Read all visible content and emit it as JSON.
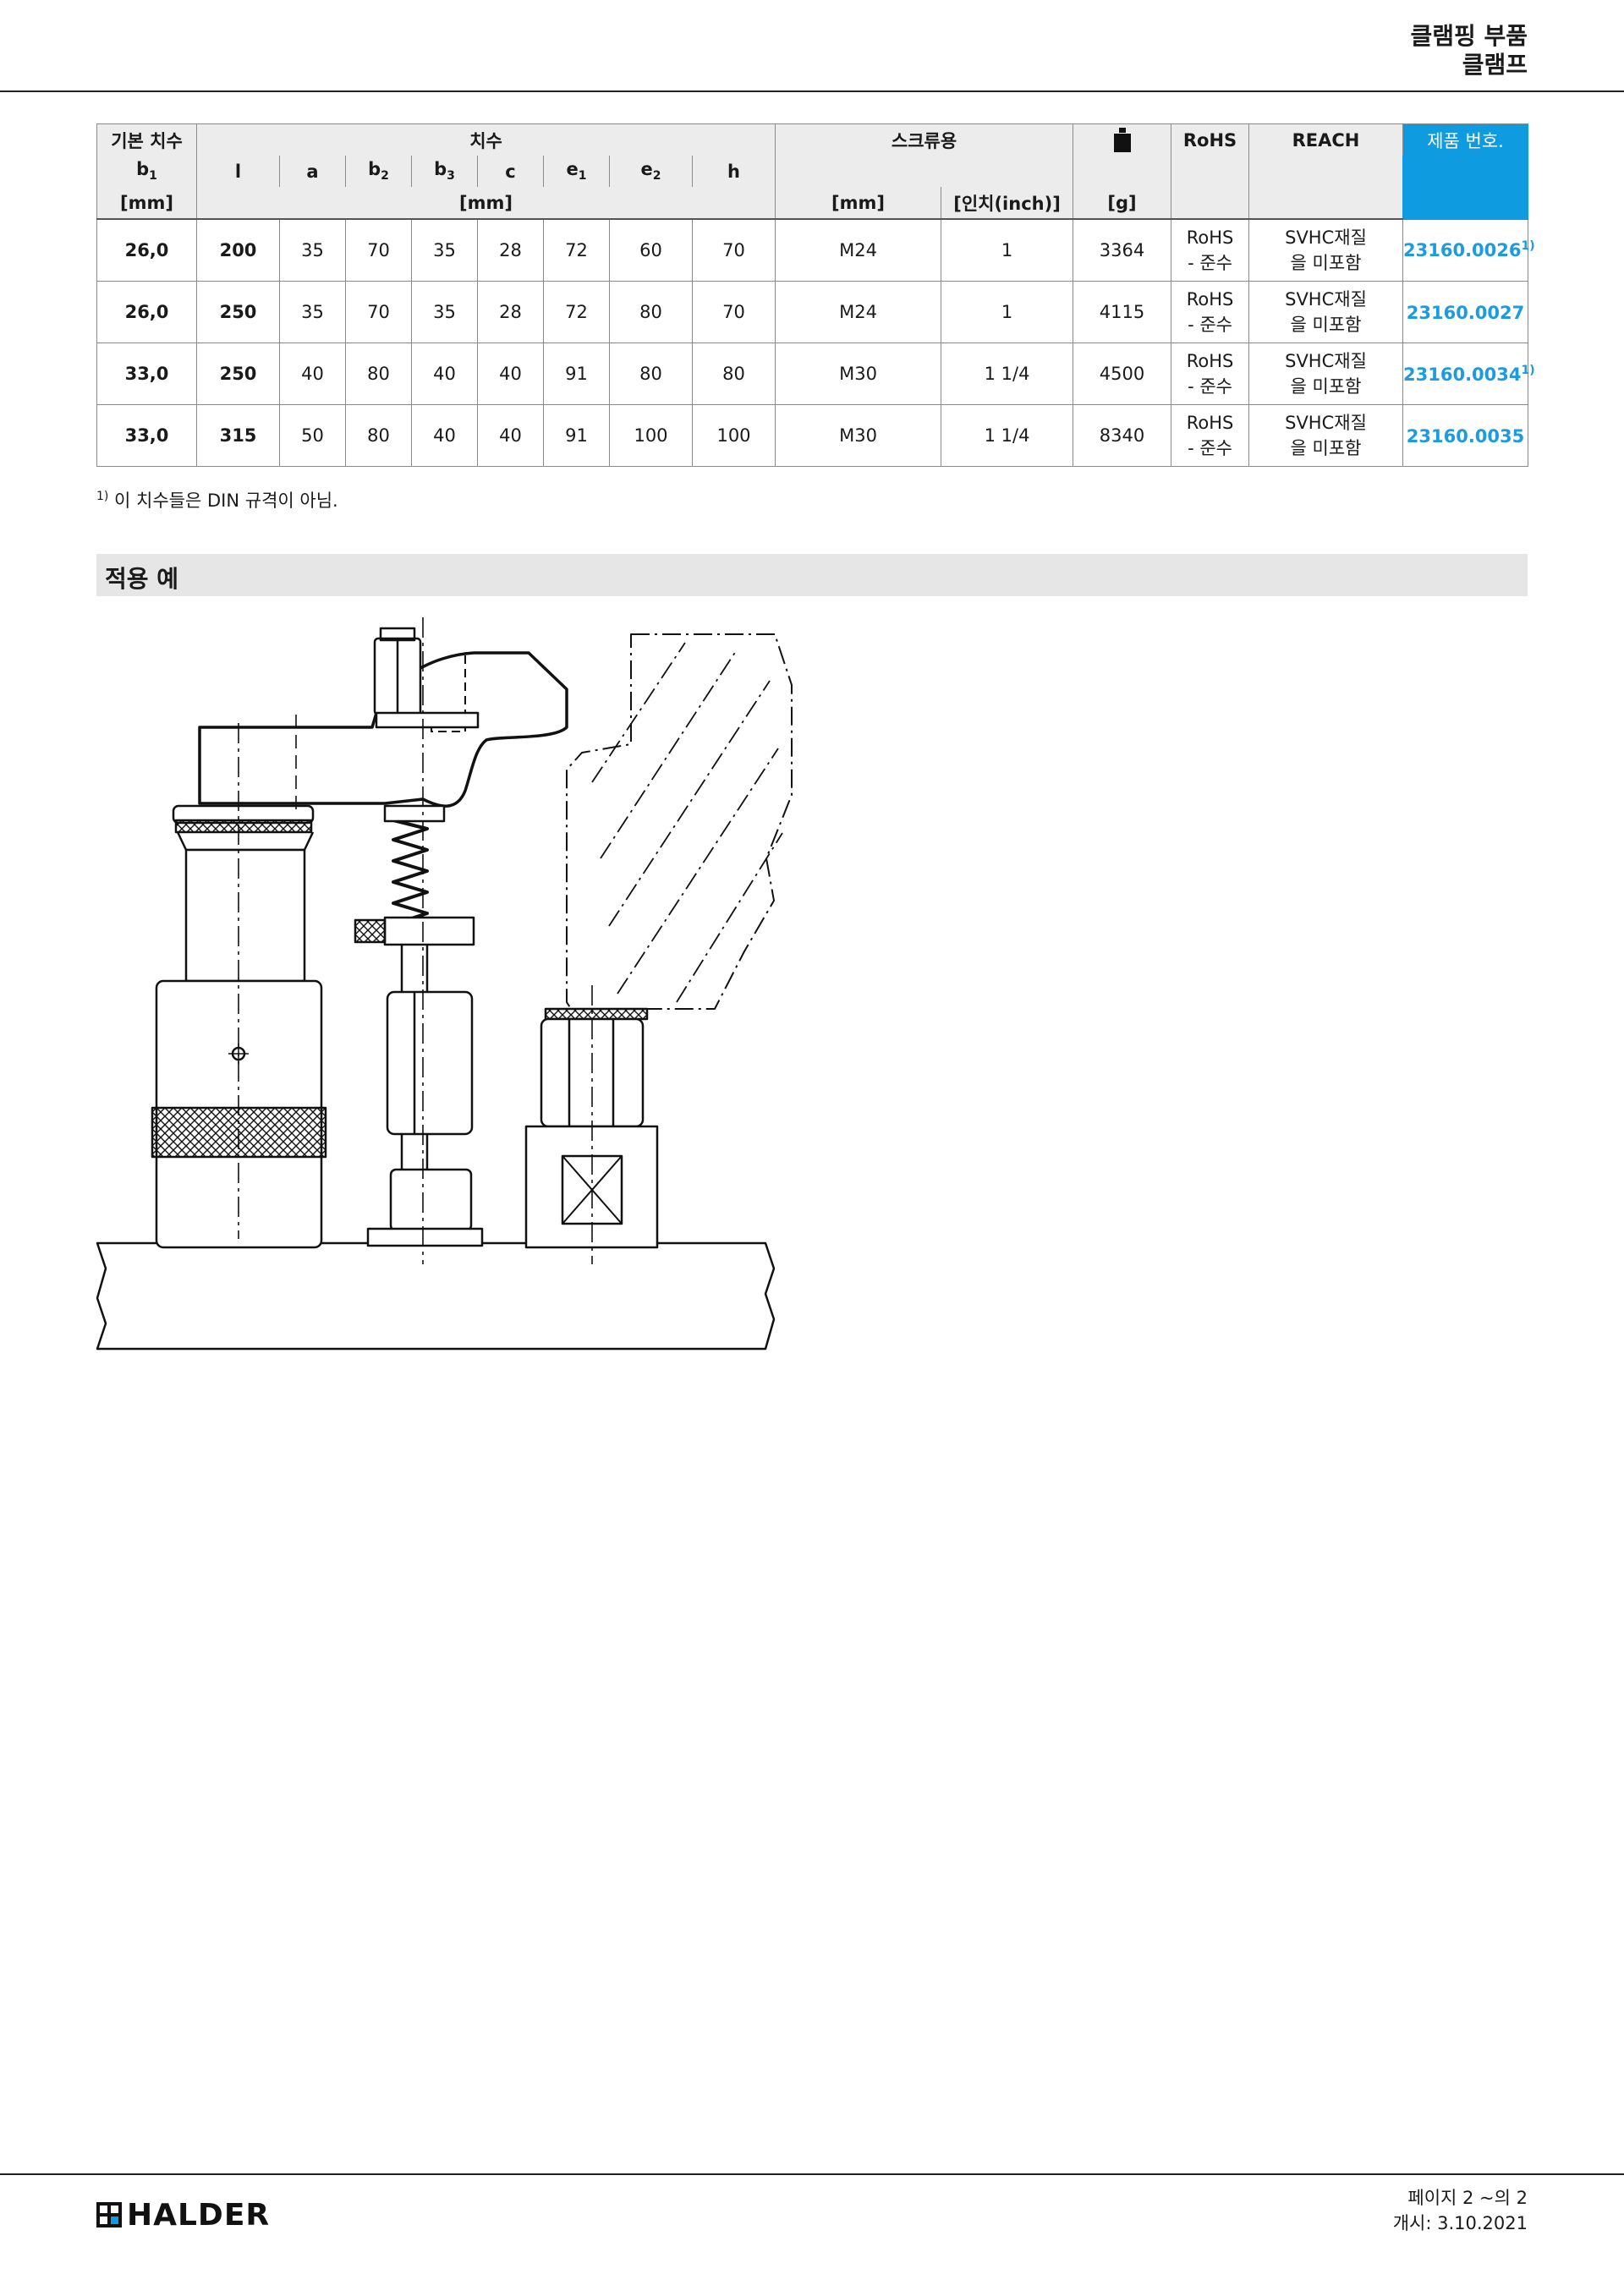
{
  "header": {
    "category": "클램핑 부품",
    "subcategory": "클램프"
  },
  "table": {
    "headers": {
      "b1_title": "기본 치수",
      "b1": "b",
      "b1_sub": "1",
      "dims_title": "치수",
      "l": "l",
      "a": "a",
      "b2": "b",
      "b2_sub": "2",
      "b3": "b",
      "b3_sub": "3",
      "c": "c",
      "e1": "e",
      "e1_sub": "1",
      "e2": "e",
      "e2_sub": "2",
      "h": "h",
      "screw_title": "스크류용",
      "rohs": "RoHS",
      "reach": "REACH",
      "product_no": "제품 번호.",
      "unit_mm_b1": "[mm]",
      "unit_mm_dims": "[mm]",
      "unit_mm_screw": "[mm]",
      "unit_inch": "[인치(inch)]",
      "unit_g": "[g]",
      "weight_icon": "weight-icon"
    },
    "rows": [
      {
        "b1": "26,0",
        "l": "200",
        "a": "35",
        "b2": "70",
        "b3": "35",
        "c": "28",
        "e1": "72",
        "e2": "60",
        "h": "70",
        "mm": "M24",
        "inch": "1",
        "g": "3364",
        "rohs1": "RoHS",
        "rohs2": "- 준수",
        "reach1": "SVHC재질",
        "reach2": "을 미포함",
        "pn": "23160.0026",
        "fn": "1)"
      },
      {
        "b1": "26,0",
        "l": "250",
        "a": "35",
        "b2": "70",
        "b3": "35",
        "c": "28",
        "e1": "72",
        "e2": "80",
        "h": "70",
        "mm": "M24",
        "inch": "1",
        "g": "4115",
        "rohs1": "RoHS",
        "rohs2": "- 준수",
        "reach1": "SVHC재질",
        "reach2": "을 미포함",
        "pn": "23160.0027",
        "fn": ""
      },
      {
        "b1": "33,0",
        "l": "250",
        "a": "40",
        "b2": "80",
        "b3": "40",
        "c": "40",
        "e1": "91",
        "e2": "80",
        "h": "80",
        "mm": "M30",
        "inch": "1 1/4",
        "g": "4500",
        "rohs1": "RoHS",
        "rohs2": "- 준수",
        "reach1": "SVHC재질",
        "reach2": "을 미포함",
        "pn": "23160.0034",
        "fn": "1)"
      },
      {
        "b1": "33,0",
        "l": "315",
        "a": "50",
        "b2": "80",
        "b3": "40",
        "c": "40",
        "e1": "91",
        "e2": "100",
        "h": "100",
        "mm": "M30",
        "inch": "1 1/4",
        "g": "8340",
        "rohs1": "RoHS",
        "rohs2": "- 준수",
        "reach1": "SVHC재질",
        "reach2": "을 미포함",
        "pn": "23160.0035",
        "fn": ""
      }
    ]
  },
  "footnote": {
    "mark": "1)",
    "text": " 이 치수들은 DIN 규격이 아님."
  },
  "section": {
    "title": "적용 예"
  },
  "footer": {
    "logo": "HALDER",
    "page": "페이지 2 ~의 2",
    "issued": "개시: 3.10.2021"
  },
  "colors": {
    "accent": "#0f9be0",
    "link": "#1c9be0",
    "header_bg": "#ececec",
    "section_bg": "#e6e6e6"
  }
}
